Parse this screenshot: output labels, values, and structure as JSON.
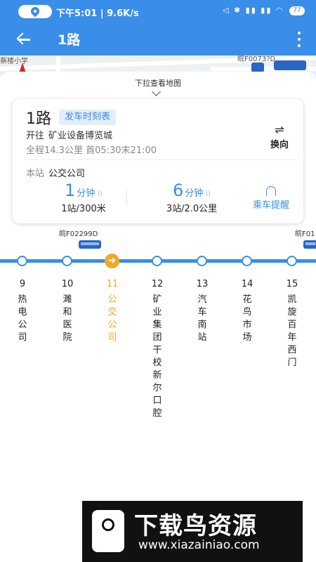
{
  "status_bar": {
    "time_speed": "下午5:01 | 9.6K/s",
    "icons": "◁ ✱ ▮▮ ▮▮ ◠",
    "battery": "77"
  },
  "header": {
    "title": "1路"
  },
  "map": {
    "labels": [
      "蔡楼小学",
      "皖F0073?D"
    ]
  },
  "sheet": {
    "pull_hint": "下拉查看地图"
  },
  "route": {
    "name": "1路",
    "timetable_label": "发车时刻表",
    "direction_prefix": "开往",
    "destination": "矿业设备博览城",
    "summary": "全程14.3公里  首05:30末21:00",
    "swap_label": "换向",
    "station_label": "本站",
    "station_name": "公交公司"
  },
  "eta": [
    {
      "minutes": "1",
      "unit": "分钟",
      "detail": "1站/300米"
    },
    {
      "minutes": "6",
      "unit": "分钟",
      "detail": "3站/2.0公里"
    }
  ],
  "remind_label": "乘车提醒",
  "buses": [
    {
      "plate": "皖F02299D"
    },
    {
      "plate": "皖F01"
    }
  ],
  "stops": [
    {
      "index": "9",
      "name": "热电公司",
      "current": false
    },
    {
      "index": "10",
      "name": "濉和医院",
      "current": false
    },
    {
      "index": "11",
      "name": "公交公司",
      "current": true
    },
    {
      "index": "12",
      "name": "矿业集团干校新尔口腔",
      "current": false
    },
    {
      "index": "13",
      "name": "汽车南站",
      "current": false
    },
    {
      "index": "14",
      "name": "花鸟市场",
      "current": false
    },
    {
      "index": "15",
      "name": "凯旋百年西门",
      "current": false
    }
  ],
  "watermark": {
    "title": "下载鸟资源",
    "url": "www.xiazainiao.com"
  },
  "colors": {
    "brand": "#3a8de8",
    "current": "#f5a623",
    "bus": "#2a66c4"
  }
}
